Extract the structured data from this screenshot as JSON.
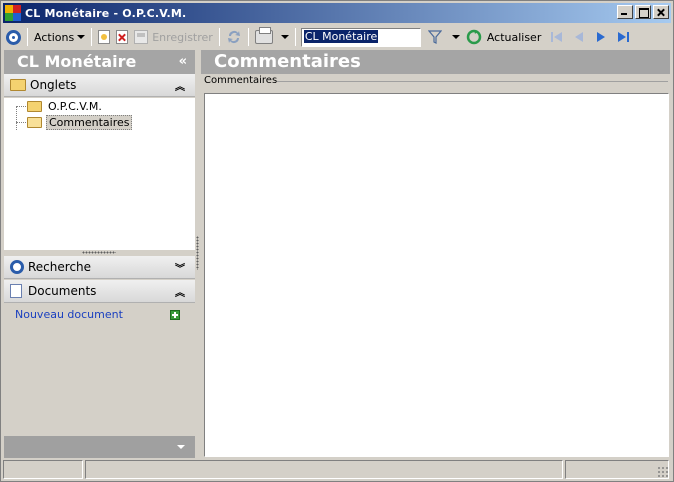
{
  "window": {
    "title": "CL Monétaire - O.P.C.V.M."
  },
  "toolbar": {
    "actions_label": "Actions",
    "save_label": "Enregistrer",
    "search_value": "CL Monétaire",
    "refresh_label": "Actualiser"
  },
  "left_panel": {
    "title": "CL Monétaire",
    "collapse_glyph": "«",
    "sections": {
      "onglets": "Onglets",
      "recherche": "Recherche",
      "documents": "Documents"
    },
    "tree": [
      {
        "label": "O.P.C.V.M."
      },
      {
        "label": "Commentaires",
        "selected": true
      }
    ],
    "new_document_link": "Nouveau document"
  },
  "main": {
    "title": "Commentaires",
    "group_label": "Commentaires",
    "content": ""
  },
  "colors": {
    "title_bar_start": "#0a246a",
    "title_bar_end": "#a6caf0",
    "panel_header": "#a5a5a5",
    "link": "#1a3fbf"
  }
}
